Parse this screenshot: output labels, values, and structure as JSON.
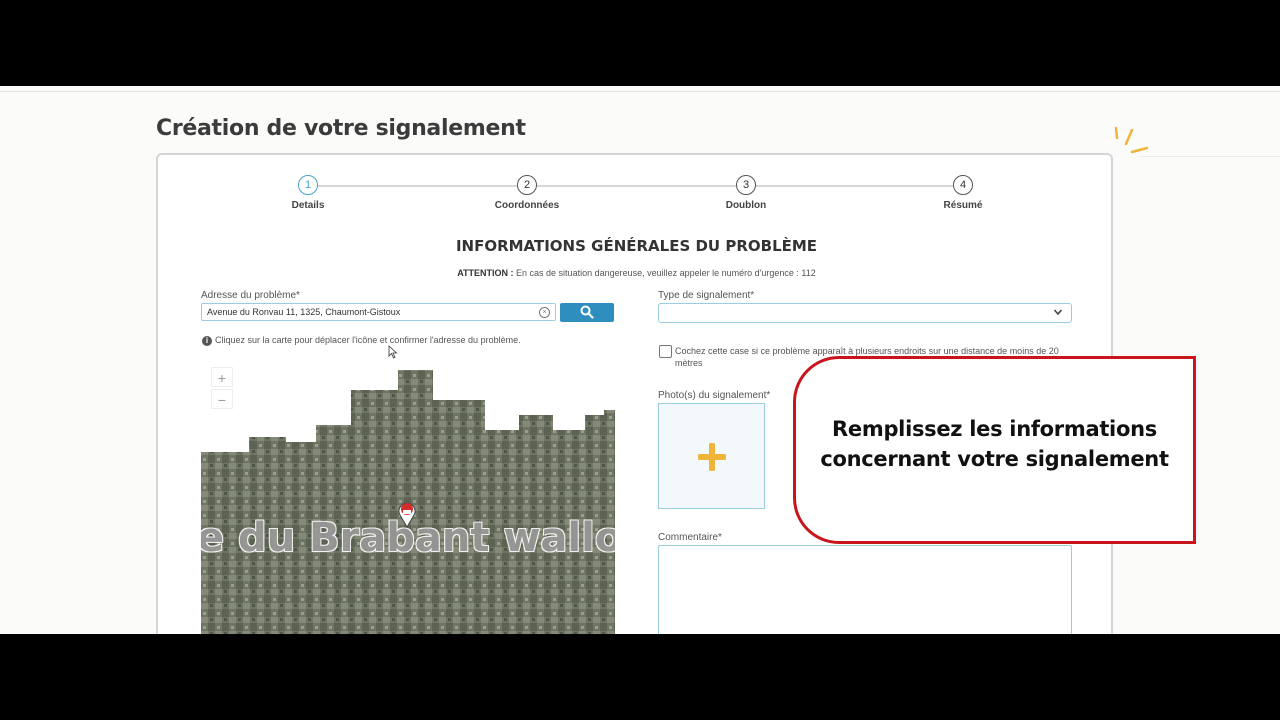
{
  "page": {
    "title": "Création de votre signalement"
  },
  "steps": [
    {
      "number": "1",
      "label": "Details"
    },
    {
      "number": "2",
      "label": "Coordonnées"
    },
    {
      "number": "3",
      "label": "Doublon"
    },
    {
      "number": "4",
      "label": "Résumé"
    }
  ],
  "active_step": 1,
  "form": {
    "section_title": "INFORMATIONS GÉNÉRALES DU PROBLÈME",
    "attention_label": "ATTENTION :",
    "attention_text": " En cas de situation dangereuse, veuillez appeler le numéro d'urgence : 112",
    "address_label": "Adresse du problème*",
    "address_value": "Avenue du Ronvau 11, 1325, Chaumont-Gistoux",
    "address_hint": "Cliquez sur la carte pour déplacer l'icône et confirmer l'adresse du problème.",
    "type_label": "Type de signalement*",
    "type_value": "",
    "checkbox_label": "Cochez cette case si ce problème apparaît à plusieurs endroits sur une distance de moins de 20 mètres",
    "checkbox_checked": false,
    "photo_label": "Photo(s) du signalement*",
    "comment_label": "Commentaire*",
    "comment_value": ""
  },
  "map": {
    "zoom_in": "+",
    "zoom_out": "−",
    "overlay_text": "e du Brabant wallo"
  },
  "callout": {
    "line1": "Remplissez les informations",
    "line2": "concernant votre signalement"
  },
  "colors": {
    "accent": "#2e8fbf",
    "field_border": "#9acde0",
    "plus": "#f0b43a",
    "callout_border": "#c8151b",
    "map_pin": "#d22c2c"
  },
  "icons": {
    "search": "search-icon",
    "dropdown": "chevron-down-icon",
    "info": "info-icon",
    "add_photo": "plus-icon",
    "map_marker": "map-pin-icon"
  }
}
